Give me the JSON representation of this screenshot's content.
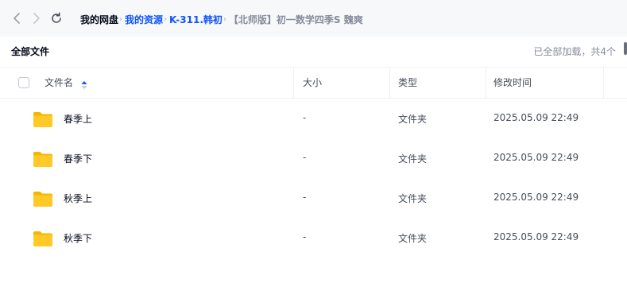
{
  "nav": {
    "back_icon": "chevron-left-icon",
    "forward_icon": "chevron-right-icon",
    "refresh_icon": "refresh-icon"
  },
  "breadcrumb": [
    "我的网盘",
    "我的资源",
    "K-311.韩初",
    "【北师版】初一数学四季S 魏爽"
  ],
  "toolbar": {
    "title": "全部文件",
    "status": "已全部加载，共4个"
  },
  "table": {
    "headers": {
      "name": "文件名",
      "size": "大小",
      "type": "类型",
      "mtime": "修改时间"
    },
    "sort_icon": "sort-ascending-icon",
    "rows": [
      {
        "name": "春季上",
        "size": "-",
        "type": "文件夹",
        "mtime": "2025.05.09 22:49",
        "icon": "folder-icon"
      },
      {
        "name": "春季下",
        "size": "-",
        "type": "文件夹",
        "mtime": "2025.05.09 22:49",
        "icon": "folder-icon"
      },
      {
        "name": "秋季上",
        "size": "-",
        "type": "文件夹",
        "mtime": "2025.05.09 22:49",
        "icon": "folder-icon"
      },
      {
        "name": "秋季下",
        "size": "-",
        "type": "文件夹",
        "mtime": "2025.05.09 22:49",
        "icon": "folder-icon"
      }
    ]
  },
  "colors": {
    "accent": "#0d53ff",
    "folder": "#ffc933",
    "muted": "#878c9c"
  }
}
